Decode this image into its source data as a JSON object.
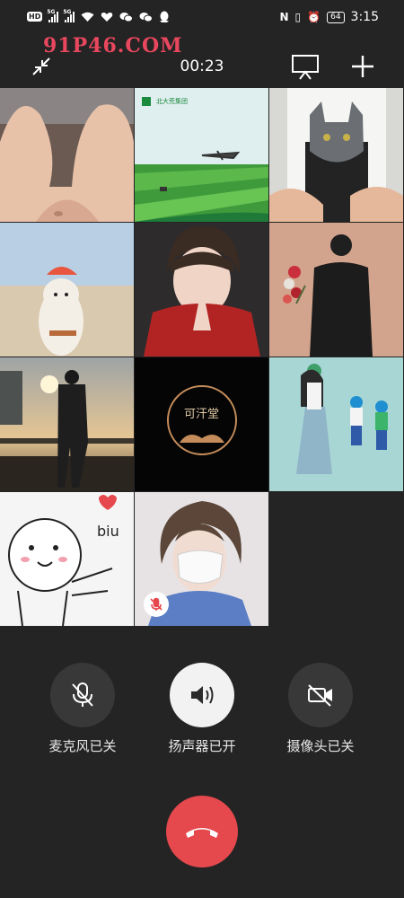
{
  "status_bar": {
    "left_badge": "HD",
    "network_1": "5G",
    "network_2": "5G",
    "battery": "64",
    "time": "3:15"
  },
  "watermark": "91P46.COM",
  "call": {
    "timer": "00:23"
  },
  "tiles": [
    {
      "name": "participant-1"
    },
    {
      "name": "participant-2",
      "logo_text": "北大荒集团"
    },
    {
      "name": "participant-3"
    },
    {
      "name": "participant-4"
    },
    {
      "name": "participant-5"
    },
    {
      "name": "participant-6"
    },
    {
      "name": "participant-7"
    },
    {
      "name": "participant-8",
      "logo_text": "可汗堂"
    },
    {
      "name": "participant-9"
    },
    {
      "name": "participant-10",
      "sticker_text": "biu"
    },
    {
      "name": "participant-11",
      "muted": true
    }
  ],
  "controls": {
    "mic_label": "麦克风已关",
    "speaker_label": "扬声器已开",
    "camera_label": "摄像头已关"
  },
  "colors": {
    "background": "#242424",
    "hangup": "#e5484d",
    "control_bg": "#383838",
    "speaker_active": "#f2f2f2"
  }
}
